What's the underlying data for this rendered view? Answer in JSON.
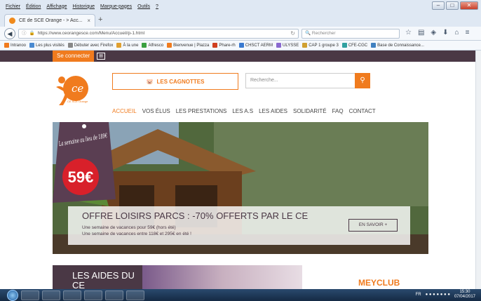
{
  "browser": {
    "menu": [
      "Fichier",
      "Édition",
      "Affichage",
      "Historique",
      "Marque-pages",
      "Outils",
      "?"
    ],
    "tab_title": "CE de SCE Orange - > Acc...",
    "url": "https://www.ceorangesce.com/Menu/Accueil/p-1.html",
    "search_placeholder": "Rechercher",
    "bookmarks": [
      {
        "label": "Intranoo",
        "color": "#f07b1e"
      },
      {
        "label": "Les plus visités",
        "color": "#4a8ad0"
      },
      {
        "label": "Débuter avec Firefox",
        "color": "#888888"
      },
      {
        "label": "À la une",
        "color": "#e0a030"
      },
      {
        "label": "Alfresco",
        "color": "#3aa040"
      },
      {
        "label": "Bienvenue | Plazza",
        "color": "#f07b1e"
      },
      {
        "label": "Phare-rh",
        "color": "#d04020"
      },
      {
        "label": "CHSCT AERM",
        "color": "#3a7ad0"
      },
      {
        "label": "ULYSSE",
        "color": "#8a6ad0"
      },
      {
        "label": "CAP 1 groupe 3",
        "color": "#d0a030"
      },
      {
        "label": "CFE-CGC",
        "color": "#30a0a0"
      },
      {
        "label": "Base de Connaissance...",
        "color": "#4080c0"
      }
    ]
  },
  "site": {
    "connect_label": "Se connecter",
    "logo_text": "CE SCE Orange",
    "cagnottes_label": "LES CAGNOTTES",
    "search_placeholder": "Recherche...",
    "nav": [
      "ACCUEIL",
      "VOS ÉLUS",
      "LES PRESTATIONS",
      "LES A.S",
      "LES AIDES",
      "SOLIDARITÉ",
      "FAQ",
      "CONTACT"
    ],
    "hero": {
      "title": "OFFRE LOISIRS PARCS : -70% OFFERTS PAR LE CE",
      "line1": "Une semaine de vacances pour 59€ (hors été)",
      "line2": "Une semaine de vacances entre 118€ et 295€ en été !",
      "button": "EN SAVOIR +",
      "tag_text": "La semaine au lieu de 189€",
      "price": "59€"
    },
    "aides_title": "LES AIDES DU CE",
    "meyclub": "MEYCLUB"
  },
  "taskbar": {
    "lang": "FR",
    "time": "15:30",
    "date": "07/04/2017"
  },
  "colors": {
    "orange": "#f07b1e",
    "plum": "#4a3845",
    "price_red": "#d8202a"
  }
}
